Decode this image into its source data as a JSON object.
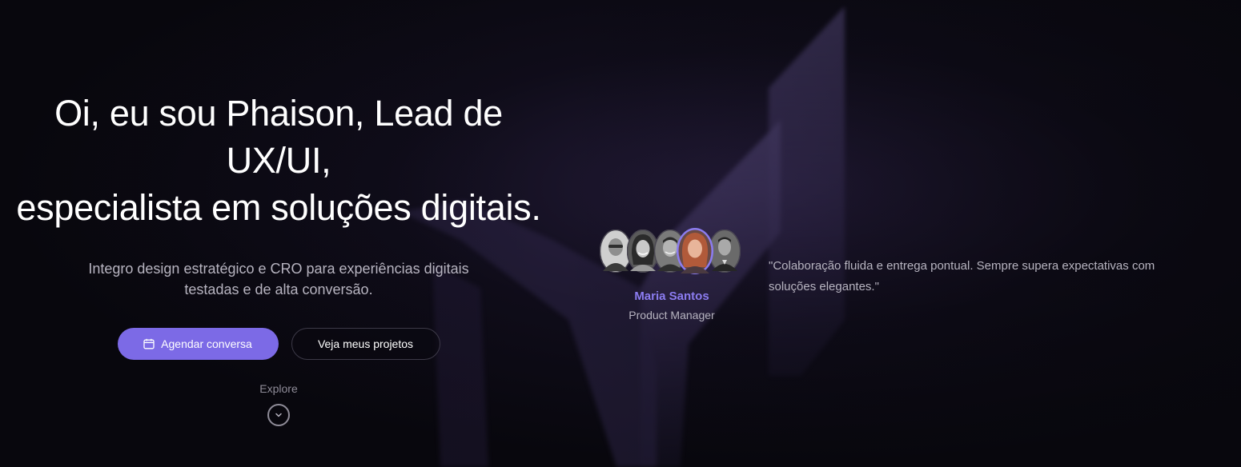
{
  "hero": {
    "headline_line1": "Oi, eu sou Phaison, Lead de",
    "headline_line2": "UX/UI,",
    "headline_line3": "especialista em soluções digitais.",
    "subtitle": "Integro design estratégico e CRO para experiências digitais testadas e de alta conversão.",
    "primary_button": {
      "label": "Agendar conversa",
      "icon": "calendar-icon"
    },
    "secondary_button": {
      "label": "Veja meus projetos"
    },
    "explore_label": "Explore",
    "explore_icon": "chevron-down-icon"
  },
  "testimonial": {
    "active_index": 3,
    "avatars": [
      "avatar-1",
      "avatar-2",
      "avatar-3",
      "avatar-4",
      "avatar-5"
    ],
    "name": "Maria Santos",
    "role": "Product Manager",
    "quote": "\"Colaboração fluida e entrega pontual. Sempre supera expectativas com soluções elegantes.\""
  },
  "colors": {
    "background": "#08070d",
    "accent": "#7c6ae6",
    "name_accent": "#8b7cf0",
    "text_primary": "#ffffff",
    "text_muted": "#b7b4c0"
  }
}
